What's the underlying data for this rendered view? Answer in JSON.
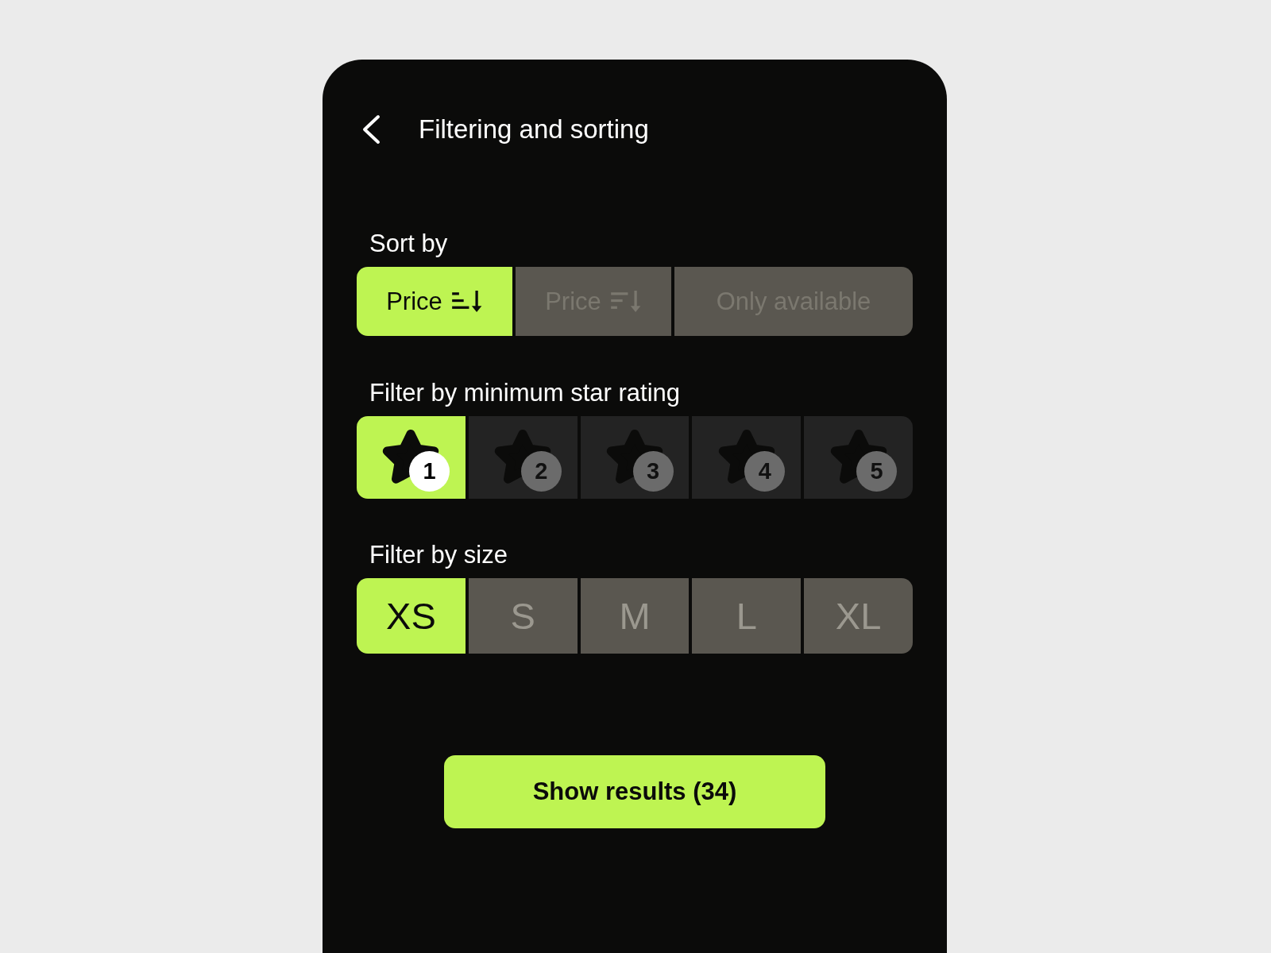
{
  "header": {
    "title": "Filtering and sorting"
  },
  "sort": {
    "label": "Sort by",
    "options": [
      {
        "label": "Price",
        "kind": "ascending",
        "selected": true
      },
      {
        "label": "Price",
        "kind": "descending",
        "selected": false
      },
      {
        "label": "Only available",
        "kind": "plain",
        "selected": false
      }
    ]
  },
  "rating": {
    "label": "Filter by minimum star rating",
    "options": [
      {
        "label": "1",
        "selected": true
      },
      {
        "label": "2",
        "selected": false
      },
      {
        "label": "3",
        "selected": false
      },
      {
        "label": "4",
        "selected": false
      },
      {
        "label": "5",
        "selected": false
      }
    ]
  },
  "size": {
    "label": "Filter by size",
    "options": [
      {
        "label": "XS",
        "selected": true
      },
      {
        "label": "S",
        "selected": false
      },
      {
        "label": "M",
        "selected": false
      },
      {
        "label": "L",
        "selected": false
      },
      {
        "label": "XL",
        "selected": false
      }
    ]
  },
  "action": {
    "label": "Show results (34)"
  }
}
